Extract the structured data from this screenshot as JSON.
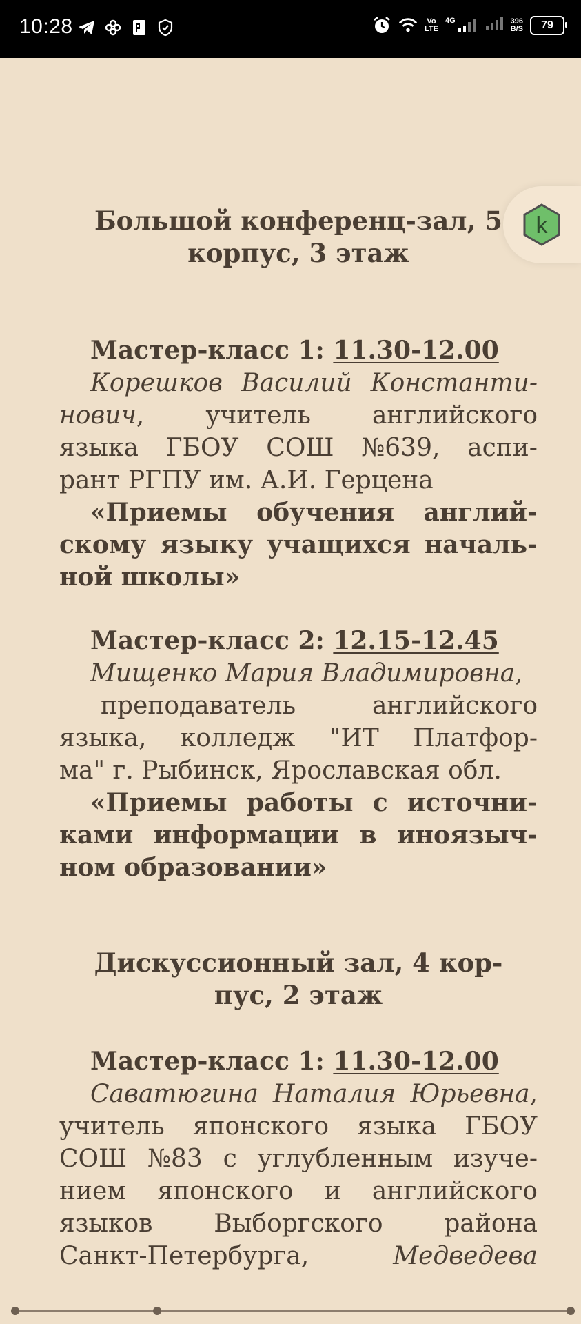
{
  "status_bar": {
    "time": "10:28",
    "left_icons": [
      "telegram-icon",
      "pinwheel-icon",
      "pdf-icon",
      "shield-check-icon"
    ],
    "right": {
      "alarm": "alarm-icon",
      "wifi": "wifi-icon",
      "volte_top": "Vo",
      "volte_bottom": "LTE",
      "network": "4G",
      "speed_value": "396",
      "speed_unit": "B/S",
      "battery": "79"
    }
  },
  "floating_button": {
    "letter": "k",
    "color": "#6fbf6a"
  },
  "sections": [
    {
      "heading_lines": [
        "Большой конференц-зал, 5",
        "корпус, 3 этаж"
      ],
      "masterclasses": [
        {
          "label": "Мастер-класс 1: ",
          "time": "11.30-12.00",
          "lines": [
            [
              "Корешков",
              "Василий",
              "Константи-"
            ],
            [
              "нович,",
              "учитель",
              "английского"
            ],
            [
              "языка",
              "ГБОУ",
              "СОШ",
              "№639,",
              "аспи-"
            ],
            [
              "рант РГПУ им. А.И. Герцена"
            ],
            [
              "«Приемы",
              "обучения",
              "англий-"
            ],
            [
              "скому",
              "языку",
              "учащихся",
              "началь-"
            ],
            [
              "ной школы»"
            ]
          ]
        },
        {
          "label": "Мастер-класс 2: ",
          "time": "12.15-12.45",
          "lines": [
            [
              "Мищенко Мария Владимировна,"
            ],
            [
              "преподаватель",
              "английского"
            ],
            [
              "языка,",
              "колледж",
              "\"ИТ",
              "Платфор-"
            ],
            [
              "ма\" г. Рыбинск, Ярославская обл."
            ],
            [
              "«Приемы",
              "работы",
              "с",
              "источни-"
            ],
            [
              "ками",
              "информации",
              "в",
              "иноязыч-"
            ],
            [
              "ном образовании»"
            ]
          ]
        }
      ]
    },
    {
      "heading_lines": [
        "Дискуссионный зал, 4 кор-",
        "пус, 2 этаж"
      ],
      "masterclasses": [
        {
          "label": "Мастер-класс 1: ",
          "time": "11.30-12.00",
          "lines": [
            [
              "Саватюгина",
              "Наталия",
              "Юрьевна,"
            ],
            [
              "учитель",
              "японского",
              "языка",
              "ГБОУ"
            ],
            [
              "СОШ",
              "№83",
              "с",
              "углубленным",
              "изуче-"
            ],
            [
              "нием",
              "японского",
              "и",
              "английского"
            ],
            [
              "языков",
              "Выборгского",
              "района"
            ],
            [
              "Санкт-Петербурга,",
              "Медведева"
            ]
          ]
        }
      ]
    }
  ]
}
